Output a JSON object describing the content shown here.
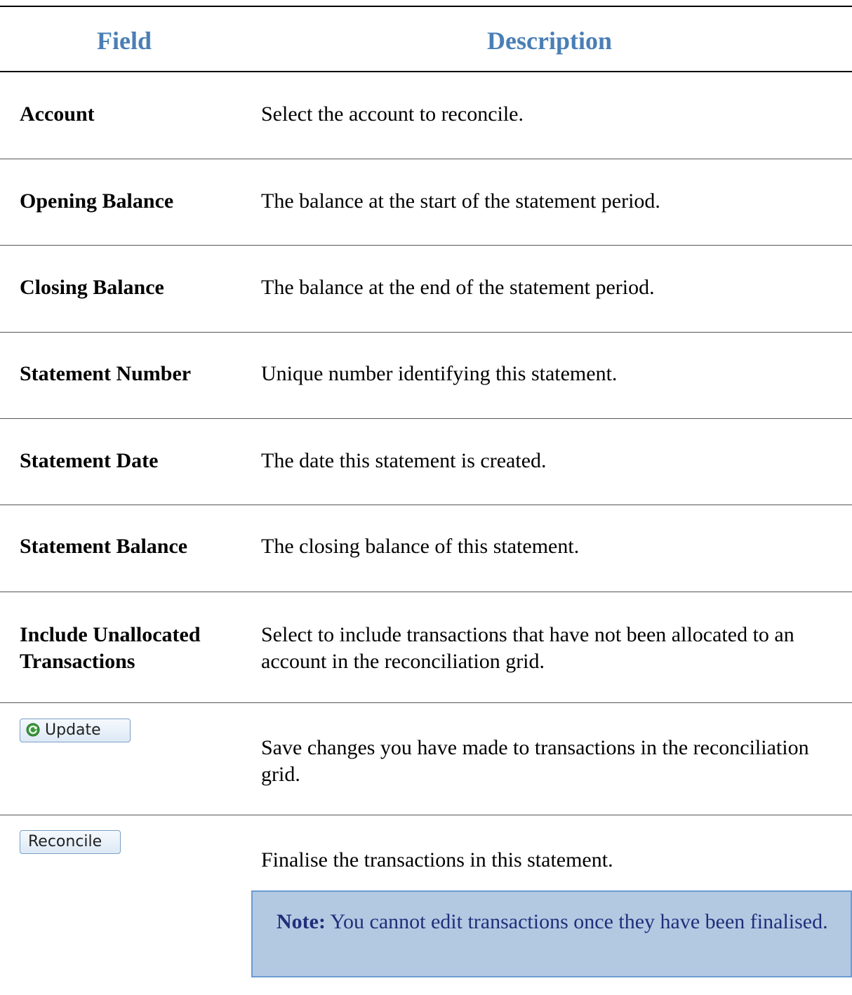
{
  "header": {
    "field": "Field",
    "description": "Description"
  },
  "rows": [
    {
      "field": "Account",
      "description": "Select the account to reconcile."
    },
    {
      "field": "Opening Balance",
      "description": "The balance at the start of the statement period."
    },
    {
      "field": "Closing Balance",
      "description": "The balance at the end of the statement period."
    },
    {
      "field": "Statement Number",
      "description": "Unique number identifying this statement."
    },
    {
      "field": "Statement Date",
      "description": "The date this statement is created."
    },
    {
      "field": "Statement Balance",
      "description": "The closing balance of this statement."
    },
    {
      "field": "Include Unallocated Transactions",
      "description": "Select to include transactions that have not been allocated to an account in the reconciliation grid."
    },
    {
      "button": "Update",
      "icon": "refresh-icon",
      "description": "Save changes you have made to transactions in the reconciliation grid."
    },
    {
      "button": "Reconcile",
      "description": "Finalise the transactions in this statement."
    }
  ],
  "note": {
    "label": "Note:",
    "text": "You cannot edit transactions once they have been finalised."
  },
  "colors": {
    "header": "#4a7fb5",
    "note_bg": "#b3c9e2",
    "note_border": "#6b9bd1",
    "note_text": "#1f2f7a"
  }
}
